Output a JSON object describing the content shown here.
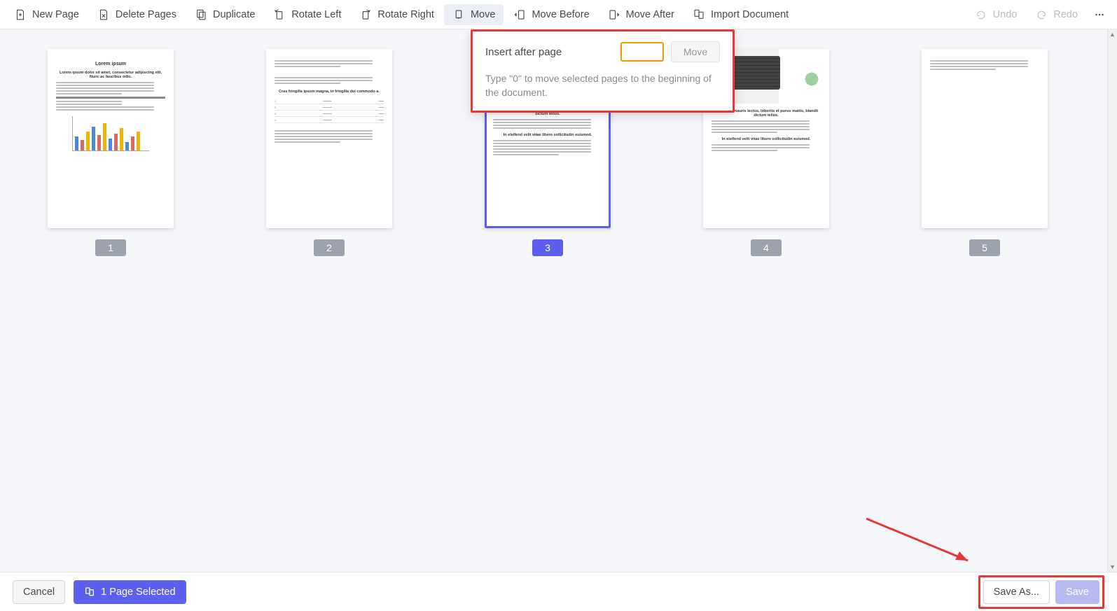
{
  "toolbar": {
    "new_page": "New Page",
    "delete_pages": "Delete Pages",
    "duplicate": "Duplicate",
    "rotate_left": "Rotate Left",
    "rotate_right": "Rotate Right",
    "move": "Move",
    "move_before": "Move Before",
    "move_after": "Move After",
    "import_document": "Import Document",
    "undo": "Undo",
    "redo": "Redo"
  },
  "popup": {
    "label": "Insert after page",
    "input_value": "",
    "move_btn": "Move",
    "hint": "Type \"0\" to move selected pages to the beginning of the document."
  },
  "pages": {
    "p1": "1",
    "p2": "2",
    "p3": "3",
    "p4": "4",
    "p5": "5",
    "selected_index": 3,
    "page1_title": "Lorem ipsum"
  },
  "footer": {
    "cancel": "Cancel",
    "selection": "1 Page Selected",
    "save_as": "Save As...",
    "save": "Save"
  }
}
